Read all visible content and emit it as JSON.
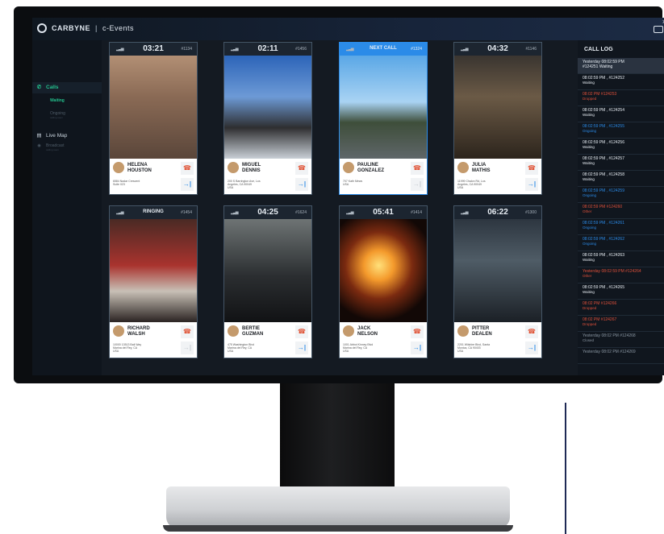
{
  "app": {
    "brand": "CARBYNE",
    "product": "c-Events",
    "close": "×"
  },
  "sidebar": {
    "calls": "Calls",
    "waiting": "Waiting",
    "ongoing": "Ongoing",
    "ongoing_sub": "calling soon",
    "live_map": "Live Map",
    "broadcast": "Broadcast",
    "broadcast_sub": "calling soon"
  },
  "cards": [
    {
      "timer": "03:21",
      "id": "#1134",
      "name1": "HELENA",
      "name2": "HOUSTON",
      "addr1": "6584 Nadar Crescent",
      "addr2": "Suite 023"
    },
    {
      "timer": "02:11",
      "id": "#1456",
      "name1": "MIGUEL",
      "name2": "DENNIS",
      "addr1": "200 S Barrington Ave, Los",
      "addr2": "Angeles, CA 90049",
      "addr3": "USA"
    },
    {
      "timer": "NEXT CALL",
      "id": "#1324",
      "name1": "PAULINE",
      "name2": "GONZALEZ",
      "addr1": "707 Kath Mews",
      "addr2": "USA"
    },
    {
      "timer": "04:32",
      "id": "#1146",
      "name1": "JULIA",
      "name2": "MATHIS",
      "addr1": "11999 Chalon Rd, Los",
      "addr2": "Angeles, CA 90049",
      "addr3": "USA"
    },
    {
      "timer": "RINGING",
      "id": "#1454",
      "name1": "RICHARD",
      "name2": "WALSH",
      "addr1": "10000 13513 Bali Way",
      "addr2": "Marina del Rey, CA",
      "addr3": "USA"
    },
    {
      "timer": "04:25",
      "id": "#1624",
      "name1": "BERTIE",
      "name2": "GUZMAN",
      "addr1": "475 Washington Blvd",
      "addr2": "Marina del Rey, CA",
      "addr3": "USA"
    },
    {
      "timer": "05:41",
      "id": "#1414",
      "name1": "JACK",
      "name2": "NELSON",
      "addr1": "1001 Abbot Kinney Blvd",
      "addr2": "Marina del Rey, CA",
      "addr3": "USA"
    },
    {
      "timer": "06:22",
      "id": "#1300",
      "name1": "PITTER",
      "name2": "DEALEN",
      "addr1": "2201 Wilshire Blvd, Santa",
      "addr2": "Monica, CA 90403",
      "addr3": "USA"
    }
  ],
  "call_log": {
    "title": "CALL LOG",
    "items": [
      {
        "line": "Yesterday 08:02:59 PM",
        "line2": "#124251 Waiting",
        "status": "",
        "color": "#e8eef4"
      },
      {
        "line": "08:02:59 PM , #124252",
        "status": "Waiting",
        "color": "#e8eef4"
      },
      {
        "line": "08:02 PM #124253",
        "status": "Dropped",
        "color": "#e0503a"
      },
      {
        "line": "08:02:59 PM , #124254",
        "status": "Waiting",
        "color": "#e8eef4"
      },
      {
        "line": "08:02:59 PM , #124255",
        "status": "Ongoing",
        "color": "#2b8be8"
      },
      {
        "line": "08:02:59 PM , #124256",
        "status": "Waiting",
        "color": "#e8eef4"
      },
      {
        "line": "08:02:59 PM , #124257",
        "status": "Waiting",
        "color": "#e8eef4"
      },
      {
        "line": "08:02:59 PM , #124258",
        "status": "Waiting",
        "color": "#e8eef4"
      },
      {
        "line": "08:02:59 PM , #124259",
        "status": "Ongoing",
        "color": "#2b8be8"
      },
      {
        "line": "08:02:59 PM #124260",
        "status": "Other",
        "color": "#e0503a"
      },
      {
        "line": "08:02:59 PM , #124261",
        "status": "Ongoing",
        "color": "#2b8be8"
      },
      {
        "line": "08:02:59 PM , #124262",
        "status": "Ongoing",
        "color": "#2b8be8"
      },
      {
        "line": "08:02:59 PM , #124263",
        "status": "Waiting",
        "color": "#e8eef4"
      },
      {
        "line": "Yesterday 08:02:59 PM #124264",
        "status": "Other",
        "color": "#e0503a"
      },
      {
        "line": "08:02:59 PM , #124265",
        "status": "Waiting",
        "color": "#e8eef4"
      },
      {
        "line": "08:02 PM #124266",
        "status": "Dropped",
        "color": "#e0503a"
      },
      {
        "line": "08:02 PM #124267",
        "status": "Dropped",
        "color": "#e0503a"
      },
      {
        "line": "Yesterday 08:02 PM #124268",
        "status": "Closed",
        "color": "#8a96a2"
      },
      {
        "line": "Yesterday 08:02 PM #124269",
        "status": "",
        "color": "#8a96a2"
      }
    ]
  }
}
